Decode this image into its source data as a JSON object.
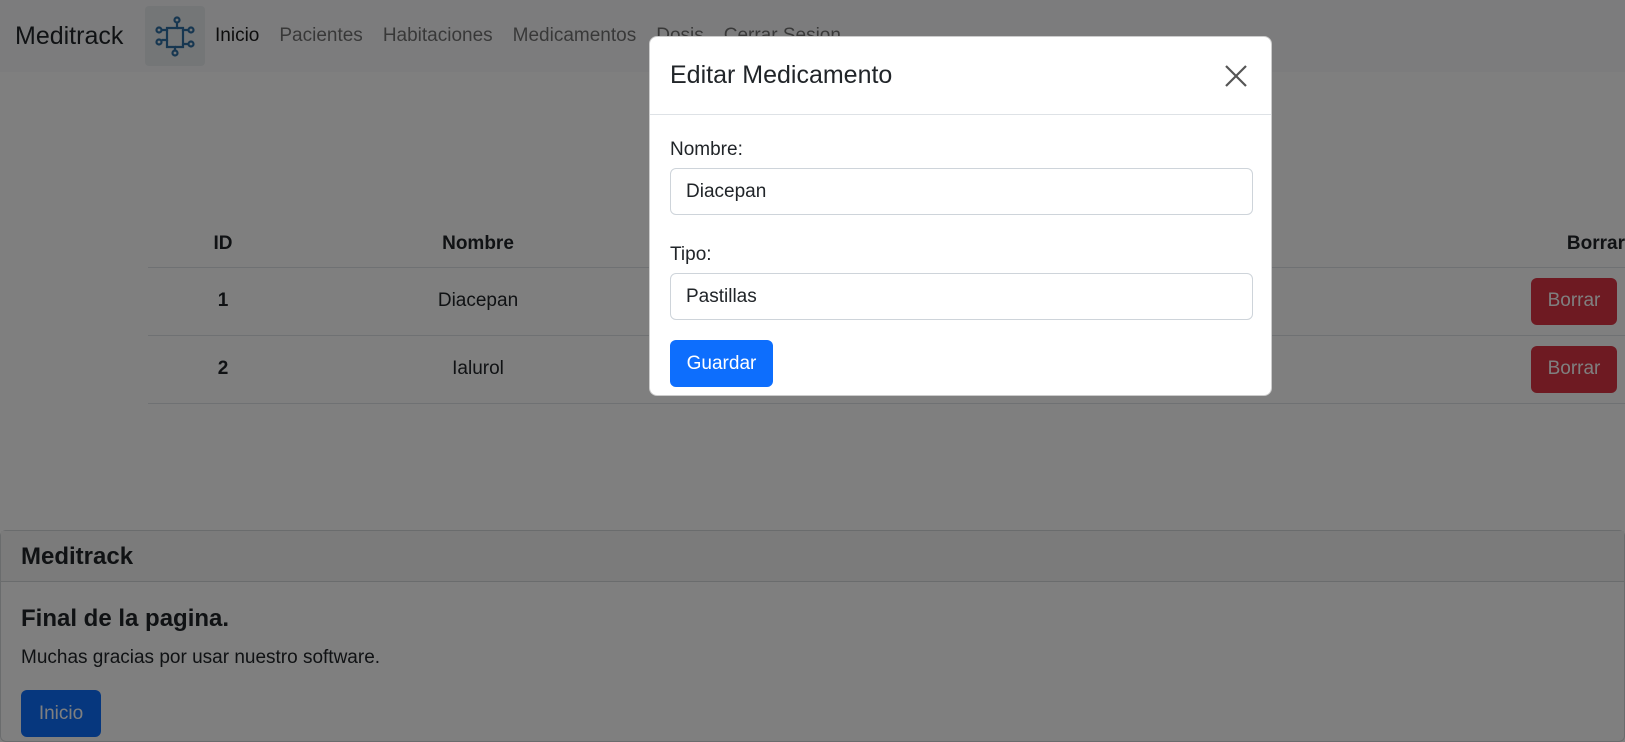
{
  "navbar": {
    "brand": "Meditrack",
    "logo_icon": "circuit-puzzle-icon",
    "links": [
      {
        "label": "Inicio",
        "active": true
      },
      {
        "label": "Pacientes"
      },
      {
        "label": "Habitaciones"
      },
      {
        "label": "Medicamentos"
      },
      {
        "label": "Dosis"
      },
      {
        "label": "Cerrar Sesion"
      }
    ]
  },
  "table": {
    "headers": {
      "id": "ID",
      "name": "Nombre",
      "borrar": "Borrar"
    },
    "rows": [
      {
        "id": "1",
        "name": "Diacepan",
        "delete_label": "Borrar"
      },
      {
        "id": "2",
        "name": "Ialurol",
        "delete_label": "Borrar"
      }
    ]
  },
  "footer": {
    "header": "Meditrack",
    "title": "Final de la pagina.",
    "text": "Muchas gracias por usar nuestro software.",
    "button_label": "Inicio"
  },
  "modal": {
    "title": "Editar Medicamento",
    "close_icon": "close-icon",
    "nombre_label": "Nombre:",
    "nombre_value": "Diacepan",
    "tipo_label": "Tipo:",
    "tipo_value": "Pastillas",
    "save_label": "Guardar"
  },
  "colors": {
    "primary": "#0d6efd",
    "danger": "#dc3545",
    "backdrop": "rgba(0,0,0,0.5)"
  }
}
